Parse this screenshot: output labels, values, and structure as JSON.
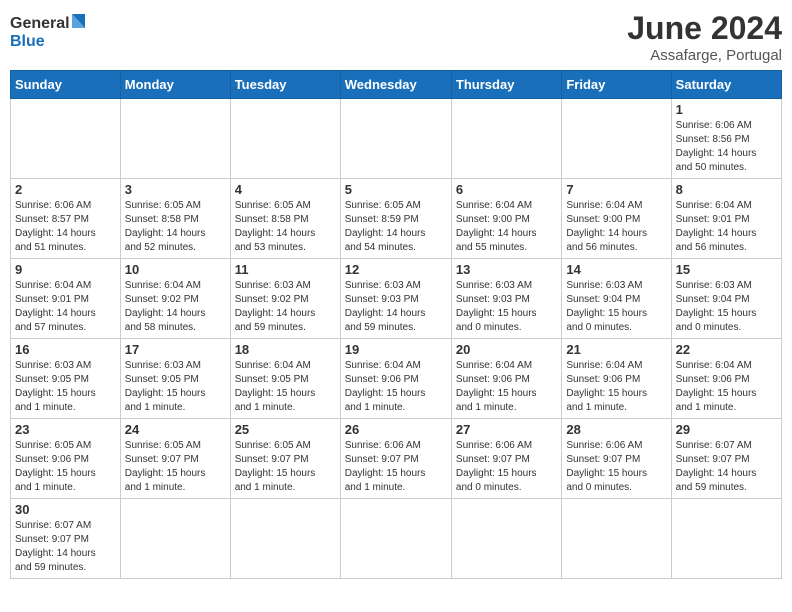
{
  "header": {
    "logo_general": "General",
    "logo_blue": "Blue",
    "title": "June 2024",
    "subtitle": "Assafarge, Portugal"
  },
  "weekdays": [
    "Sunday",
    "Monday",
    "Tuesday",
    "Wednesday",
    "Thursday",
    "Friday",
    "Saturday"
  ],
  "weeks": [
    [
      {
        "day": "",
        "info": ""
      },
      {
        "day": "",
        "info": ""
      },
      {
        "day": "",
        "info": ""
      },
      {
        "day": "",
        "info": ""
      },
      {
        "day": "",
        "info": ""
      },
      {
        "day": "",
        "info": ""
      },
      {
        "day": "1",
        "info": "Sunrise: 6:06 AM\nSunset: 8:56 PM\nDaylight: 14 hours\nand 50 minutes."
      }
    ],
    [
      {
        "day": "2",
        "info": "Sunrise: 6:06 AM\nSunset: 8:57 PM\nDaylight: 14 hours\nand 51 minutes."
      },
      {
        "day": "3",
        "info": "Sunrise: 6:05 AM\nSunset: 8:58 PM\nDaylight: 14 hours\nand 52 minutes."
      },
      {
        "day": "4",
        "info": "Sunrise: 6:05 AM\nSunset: 8:58 PM\nDaylight: 14 hours\nand 53 minutes."
      },
      {
        "day": "5",
        "info": "Sunrise: 6:05 AM\nSunset: 8:59 PM\nDaylight: 14 hours\nand 54 minutes."
      },
      {
        "day": "6",
        "info": "Sunrise: 6:04 AM\nSunset: 9:00 PM\nDaylight: 14 hours\nand 55 minutes."
      },
      {
        "day": "7",
        "info": "Sunrise: 6:04 AM\nSunset: 9:00 PM\nDaylight: 14 hours\nand 56 minutes."
      },
      {
        "day": "8",
        "info": "Sunrise: 6:04 AM\nSunset: 9:01 PM\nDaylight: 14 hours\nand 56 minutes."
      }
    ],
    [
      {
        "day": "9",
        "info": "Sunrise: 6:04 AM\nSunset: 9:01 PM\nDaylight: 14 hours\nand 57 minutes."
      },
      {
        "day": "10",
        "info": "Sunrise: 6:04 AM\nSunset: 9:02 PM\nDaylight: 14 hours\nand 58 minutes."
      },
      {
        "day": "11",
        "info": "Sunrise: 6:03 AM\nSunset: 9:02 PM\nDaylight: 14 hours\nand 59 minutes."
      },
      {
        "day": "12",
        "info": "Sunrise: 6:03 AM\nSunset: 9:03 PM\nDaylight: 14 hours\nand 59 minutes."
      },
      {
        "day": "13",
        "info": "Sunrise: 6:03 AM\nSunset: 9:03 PM\nDaylight: 15 hours\nand 0 minutes."
      },
      {
        "day": "14",
        "info": "Sunrise: 6:03 AM\nSunset: 9:04 PM\nDaylight: 15 hours\nand 0 minutes."
      },
      {
        "day": "15",
        "info": "Sunrise: 6:03 AM\nSunset: 9:04 PM\nDaylight: 15 hours\nand 0 minutes."
      }
    ],
    [
      {
        "day": "16",
        "info": "Sunrise: 6:03 AM\nSunset: 9:05 PM\nDaylight: 15 hours\nand 1 minute."
      },
      {
        "day": "17",
        "info": "Sunrise: 6:03 AM\nSunset: 9:05 PM\nDaylight: 15 hours\nand 1 minute."
      },
      {
        "day": "18",
        "info": "Sunrise: 6:04 AM\nSunset: 9:05 PM\nDaylight: 15 hours\nand 1 minute."
      },
      {
        "day": "19",
        "info": "Sunrise: 6:04 AM\nSunset: 9:06 PM\nDaylight: 15 hours\nand 1 minute."
      },
      {
        "day": "20",
        "info": "Sunrise: 6:04 AM\nSunset: 9:06 PM\nDaylight: 15 hours\nand 1 minute."
      },
      {
        "day": "21",
        "info": "Sunrise: 6:04 AM\nSunset: 9:06 PM\nDaylight: 15 hours\nand 1 minute."
      },
      {
        "day": "22",
        "info": "Sunrise: 6:04 AM\nSunset: 9:06 PM\nDaylight: 15 hours\nand 1 minute."
      }
    ],
    [
      {
        "day": "23",
        "info": "Sunrise: 6:05 AM\nSunset: 9:06 PM\nDaylight: 15 hours\nand 1 minute."
      },
      {
        "day": "24",
        "info": "Sunrise: 6:05 AM\nSunset: 9:07 PM\nDaylight: 15 hours\nand 1 minute."
      },
      {
        "day": "25",
        "info": "Sunrise: 6:05 AM\nSunset: 9:07 PM\nDaylight: 15 hours\nand 1 minute."
      },
      {
        "day": "26",
        "info": "Sunrise: 6:06 AM\nSunset: 9:07 PM\nDaylight: 15 hours\nand 1 minute."
      },
      {
        "day": "27",
        "info": "Sunrise: 6:06 AM\nSunset: 9:07 PM\nDaylight: 15 hours\nand 0 minutes."
      },
      {
        "day": "28",
        "info": "Sunrise: 6:06 AM\nSunset: 9:07 PM\nDaylight: 15 hours\nand 0 minutes."
      },
      {
        "day": "29",
        "info": "Sunrise: 6:07 AM\nSunset: 9:07 PM\nDaylight: 14 hours\nand 59 minutes."
      }
    ],
    [
      {
        "day": "30",
        "info": "Sunrise: 6:07 AM\nSunset: 9:07 PM\nDaylight: 14 hours\nand 59 minutes."
      },
      {
        "day": "",
        "info": ""
      },
      {
        "day": "",
        "info": ""
      },
      {
        "day": "",
        "info": ""
      },
      {
        "day": "",
        "info": ""
      },
      {
        "day": "",
        "info": ""
      },
      {
        "day": "",
        "info": ""
      }
    ]
  ]
}
